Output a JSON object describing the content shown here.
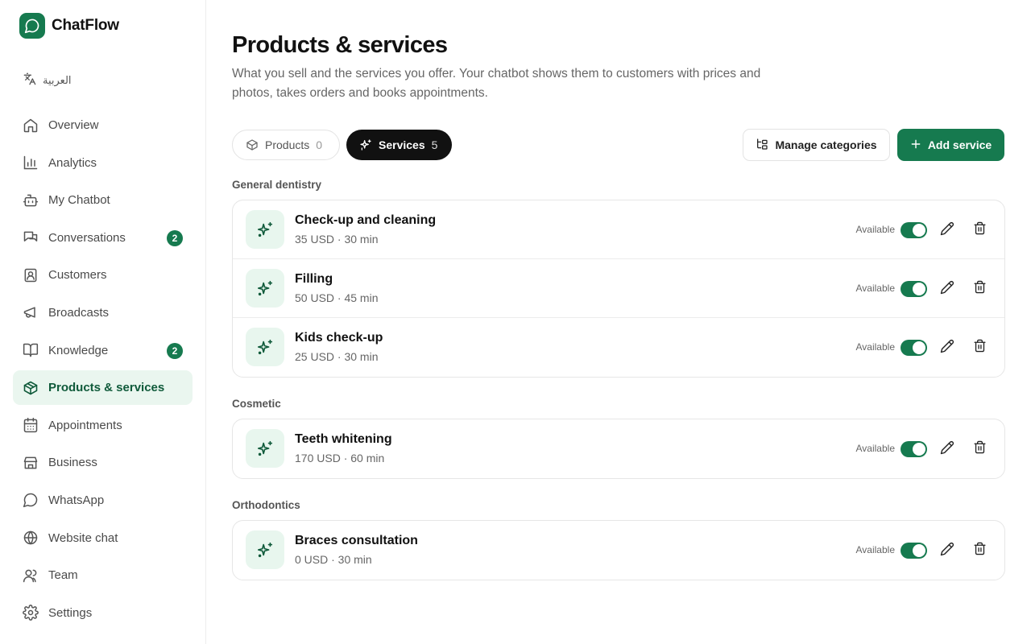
{
  "brand": {
    "name": "ChatFlow"
  },
  "language": {
    "label": "العربية"
  },
  "sidebar": {
    "items": [
      {
        "label": "Overview",
        "icon": "home-icon"
      },
      {
        "label": "Analytics",
        "icon": "bar-chart-icon"
      },
      {
        "label": "My Chatbot",
        "icon": "bot-icon"
      },
      {
        "label": "Conversations",
        "icon": "chat-bubbles-icon",
        "badge": "2"
      },
      {
        "label": "Customers",
        "icon": "contact-icon"
      },
      {
        "label": "Broadcasts",
        "icon": "megaphone-icon"
      },
      {
        "label": "Knowledge",
        "icon": "book-icon",
        "badge": "2"
      },
      {
        "label": "Products & services",
        "icon": "box-icon",
        "active": true
      },
      {
        "label": "Appointments",
        "icon": "calendar-icon"
      },
      {
        "label": "Business",
        "icon": "store-icon"
      },
      {
        "label": "WhatsApp",
        "icon": "chat-circle-icon"
      },
      {
        "label": "Website chat",
        "icon": "globe-icon"
      },
      {
        "label": "Team",
        "icon": "users-icon"
      },
      {
        "label": "Settings",
        "icon": "gear-icon"
      }
    ]
  },
  "page": {
    "title": "Products & services",
    "description": "What you sell and the services you offer. Your chatbot shows them to customers with prices and photos, takes orders and books appointments."
  },
  "tabs": [
    {
      "label": "Products",
      "count": "0",
      "active": false
    },
    {
      "label": "Services",
      "count": "5",
      "active": true
    }
  ],
  "actions": {
    "manage_label": "Manage categories",
    "add_label": "Add service"
  },
  "categories": [
    {
      "name": "General dentistry",
      "services": [
        {
          "name": "Check-up and cleaning",
          "meta": "35 USD · 30 min",
          "status": "Available",
          "enabled": true
        },
        {
          "name": "Filling",
          "meta": "50 USD · 45 min",
          "status": "Available",
          "enabled": true
        },
        {
          "name": "Kids check-up",
          "meta": "25 USD · 30 min",
          "status": "Available",
          "enabled": true
        }
      ]
    },
    {
      "name": "Cosmetic",
      "services": [
        {
          "name": "Teeth whitening",
          "meta": "170 USD · 60 min",
          "status": "Available",
          "enabled": true
        }
      ]
    },
    {
      "name": "Orthodontics",
      "services": [
        {
          "name": "Braces consultation",
          "meta": "0 USD · 30 min",
          "status": "Available",
          "enabled": true
        }
      ]
    }
  ],
  "colors": {
    "accent": "#167a4f",
    "accent_soft": "#e8f6ee",
    "active_tab": "#111111"
  }
}
